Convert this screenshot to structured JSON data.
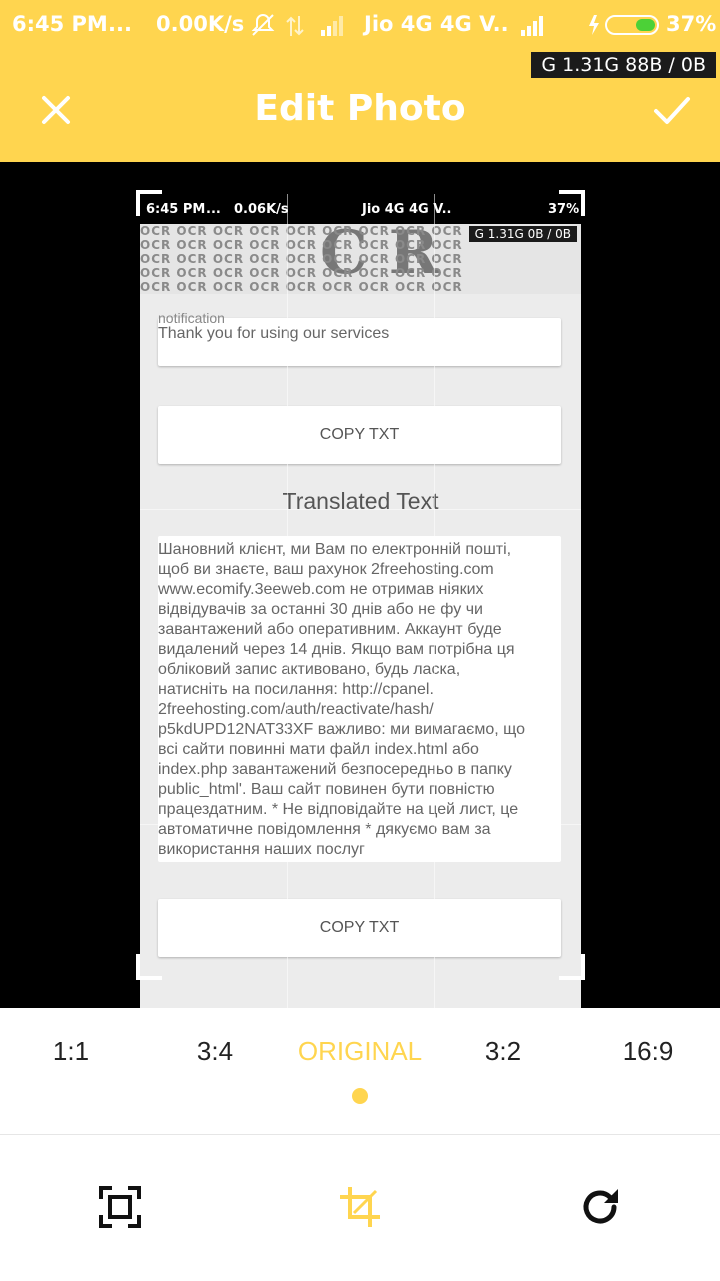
{
  "status_bar": {
    "time": "6:45 PM",
    "dots": "...",
    "speed": "0.00K/s",
    "carrier": "Jio 4G 4G V..",
    "battery": "37%",
    "net_badge": "G 1.31G  88B / 0B"
  },
  "app_bar": {
    "title": "Edit Photo",
    "close_icon": "close-icon",
    "confirm_icon": "check-icon"
  },
  "photo": {
    "status_time": "6:45 PM",
    "status_dots": "...",
    "status_speed": "0.06K/s",
    "status_carrier": "Jio 4G 4G V..",
    "status_battery": "37%",
    "status_badge": "G 1.31G  0B / 0B",
    "ocr_word": "OCR",
    "top_text_partial": "notification",
    "top_text": "Thank you for using our services",
    "copy_button_1": "COPY TXT",
    "translated_title": "Translated Text",
    "translated_lines": [
      "Шановний клієнт, ми Вам по електронній пошті,",
      "щоб ви знаєте, ваш рахунок 2freehosting.com",
      "www.ecomify.3eeweb.com не отримав ніяких",
      "відвідувачів за останні 30 днів або не фу чи",
      "завантажений або оперативним. Аккаунт буде",
      "видалений через 14 днів. Якщо вам потрібна ця",
      "обліковий запис активовано, будь ласка,",
      "натисніть на посилання: http://cpanel.",
      "2freehosting.com/auth/reactivate/hash/",
      "p5kdUPD12NAT33XF важливо: ми вимагаємо, що",
      "всі сайти повинні мати файл index.html або",
      "index.php завантажений безпосередньо в папку",
      "public_html'. Ваш сайт повинен бути повністю",
      "працездатним. * Не відповідайте на цей лист, це",
      "автоматичне повідомлення * дякуємо вам за",
      "використання наших послуг"
    ],
    "copy_button_2": "COPY TXT"
  },
  "aspect_ratios": {
    "items": [
      "1:1",
      "3:4",
      "ORIGINAL",
      "3:2",
      "16:9"
    ],
    "selected": "ORIGINAL"
  },
  "tools": {
    "fit_icon": "fit-frame-icon",
    "crop_icon": "crop-icon",
    "rotate_icon": "rotate-icon"
  },
  "colors": {
    "accent": "#FFD54F",
    "canvas": "#000000"
  }
}
